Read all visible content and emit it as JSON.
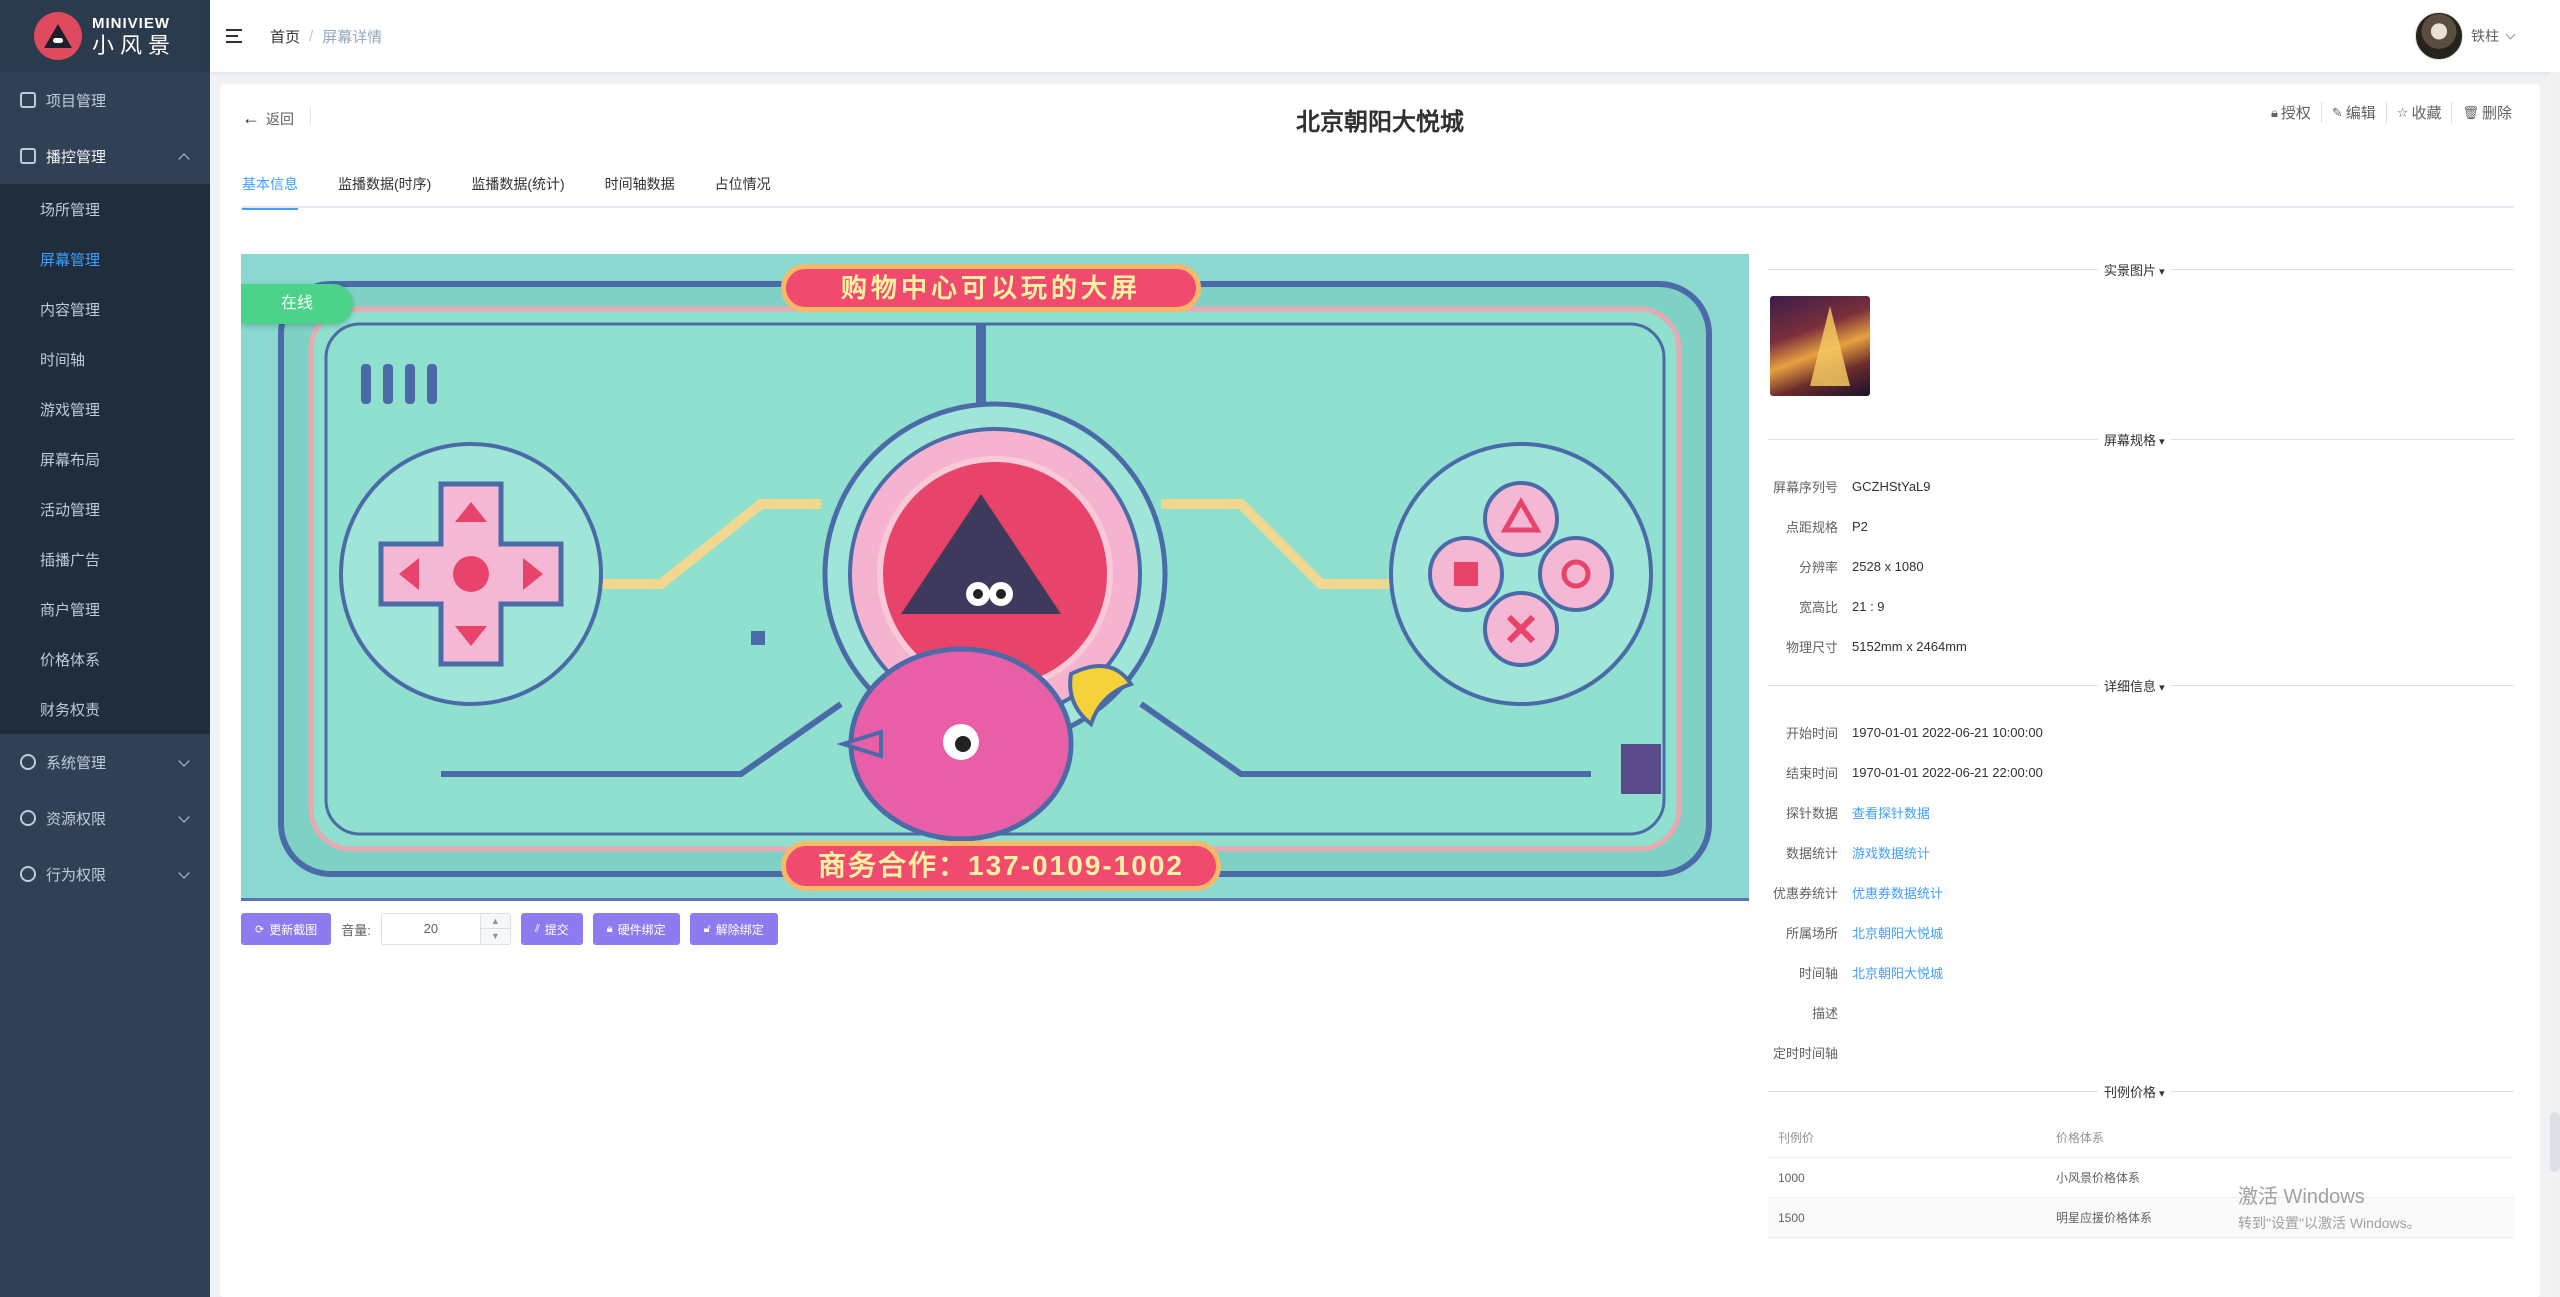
{
  "brand": {
    "name_en": "MINIVIEW",
    "name_cn": "小风景"
  },
  "sidebar": {
    "items": [
      {
        "label": "项目管理",
        "icon": "home-icon"
      },
      {
        "label": "播控管理",
        "icon": "monitor-icon",
        "expanded": true,
        "children": [
          "场所管理",
          "屏幕管理",
          "内容管理",
          "时间轴",
          "游戏管理",
          "屏幕布局",
          "活动管理",
          "插播广告",
          "商户管理",
          "价格体系",
          "财务权责"
        ],
        "active_child": "屏幕管理"
      },
      {
        "label": "系统管理",
        "icon": "gear-icon"
      },
      {
        "label": "资源权限",
        "icon": "shield-icon"
      },
      {
        "label": "行为权限",
        "icon": "user-icon"
      }
    ]
  },
  "header": {
    "breadcrumb": {
      "home": "首页",
      "separator": "/",
      "current": "屏幕详情"
    },
    "user_name": "铁柱"
  },
  "page": {
    "back_label": "返回",
    "title": "北京朝阳大悦城",
    "actions": [
      {
        "label": "授权",
        "icon": "lock-icon"
      },
      {
        "label": "编辑",
        "icon": "edit-icon"
      },
      {
        "label": "收藏",
        "icon": "star-icon"
      },
      {
        "label": "删除",
        "icon": "trash-icon"
      }
    ],
    "tabs": [
      "基本信息",
      "监播数据(时序)",
      "监播数据(统计)",
      "时间轴数据",
      "占位情况"
    ],
    "active_tab": "基本信息"
  },
  "screen": {
    "status": "在线",
    "banner_top": "购物中心可以玩的大屏",
    "banner_bottom": "商务合作：137-0109-1002"
  },
  "controls": {
    "refresh_label": "更新截图",
    "volume_label": "音量:",
    "volume_value": "20",
    "submit_label": "提交",
    "bind_label": "硬件绑定",
    "unbind_label": "解除绑定"
  },
  "info": {
    "photo_section": "实景图片",
    "spec_section": "屏幕规格",
    "specs": [
      {
        "label": "屏幕序列号",
        "value": "GCZHStYaL9"
      },
      {
        "label": "点距规格",
        "value": "P2"
      },
      {
        "label": "分辨率",
        "value": "2528 x 1080"
      },
      {
        "label": "宽高比",
        "value": "21 : 9"
      },
      {
        "label": "物理尺寸",
        "value": "5152mm x 2464mm"
      }
    ],
    "detail_section": "详细信息",
    "details": [
      {
        "label": "开始时间",
        "value": "1970-01-01 2022-06-21 10:00:00",
        "link": false
      },
      {
        "label": "结束时间",
        "value": "1970-01-01 2022-06-21 22:00:00",
        "link": false
      },
      {
        "label": "探针数据",
        "value": "查看探针数据",
        "link": true
      },
      {
        "label": "数据统计",
        "value": "游戏数据统计",
        "link": true
      },
      {
        "label": "优惠券统计",
        "value": "优惠券数据统计",
        "link": true
      },
      {
        "label": "所属场所",
        "value": "北京朝阳大悦城",
        "link": true
      },
      {
        "label": "时间轴",
        "value": "北京朝阳大悦城",
        "link": true
      },
      {
        "label": "描述",
        "value": "",
        "link": false
      },
      {
        "label": "定时时间轴",
        "value": "",
        "link": false
      }
    ],
    "price_section": "刊例价格",
    "price_table": {
      "headers": [
        "刊例价",
        "价格体系"
      ],
      "rows": [
        [
          "1000",
          "小风景价格体系"
        ],
        [
          "1500",
          "明星应援价格体系"
        ]
      ]
    }
  },
  "watermark": {
    "title": "激活 Windows",
    "subtitle": "转到\"设置\"以激活 Windows。"
  },
  "colors": {
    "sidebar_bg": "#304156",
    "accent": "#409eff",
    "button": "#8c7cf0",
    "online": "#4bd389"
  }
}
